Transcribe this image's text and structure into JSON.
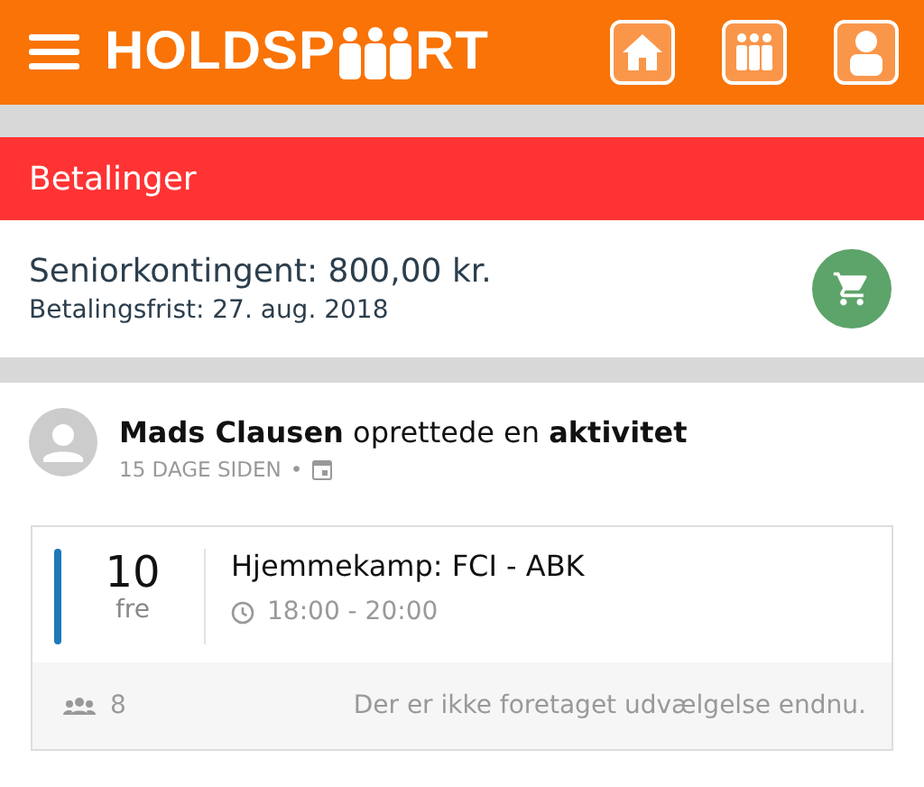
{
  "header": {
    "logo_start": "HOLDSP",
    "logo_end": "RT"
  },
  "payments": {
    "title": "Betalinger",
    "item": {
      "name": "Seniorkontingent: 800,00 kr.",
      "deadline": "Betalingsfrist: 27. aug. 2018"
    }
  },
  "feed": {
    "post": {
      "text": "**Mads Clausen** oprettede en **aktivitet**",
      "time": "15 DAGE SIDEN",
      "separator": "•"
    },
    "event": {
      "day": "10",
      "weekday": "fre",
      "color": "#1f78b8",
      "title": "Hjemmekamp: FCI - ABK",
      "time": "18:00 - 20:00",
      "participants": "8",
      "note": "Der er ikke foretaget udvælgelse endnu."
    }
  }
}
